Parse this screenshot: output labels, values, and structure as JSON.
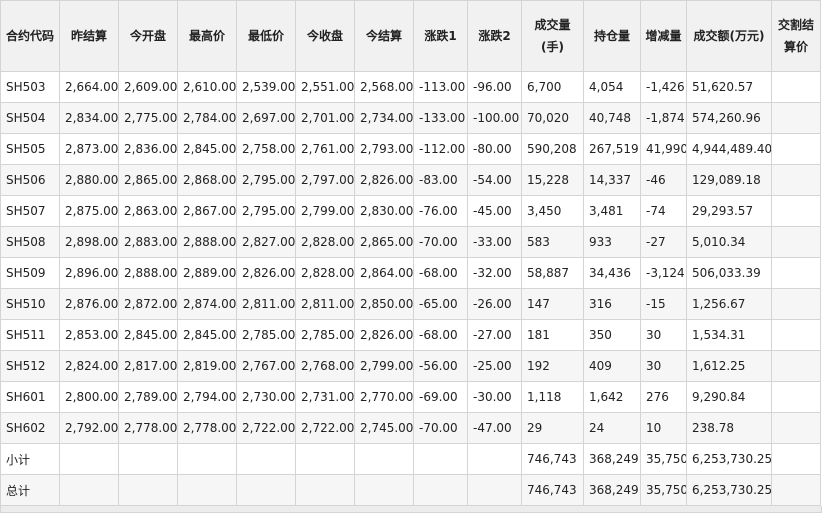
{
  "columns": [
    "合约代码",
    "昨结算",
    "今开盘",
    "最高价",
    "最低价",
    "今收盘",
    "今结算",
    "涨跌1",
    "涨跌2",
    "成交量(手)",
    "持仓量",
    "增减量",
    "成交额(万元)",
    "交割结算价"
  ],
  "rows": [
    [
      "SH503",
      "2,664.00",
      "2,609.00",
      "2,610.00",
      "2,539.00",
      "2,551.00",
      "2,568.00",
      "-113.00",
      "-96.00",
      "6,700",
      "4,054",
      "-1,426",
      "51,620.57",
      ""
    ],
    [
      "SH504",
      "2,834.00",
      "2,775.00",
      "2,784.00",
      "2,697.00",
      "2,701.00",
      "2,734.00",
      "-133.00",
      "-100.00",
      "70,020",
      "40,748",
      "-1,874",
      "574,260.96",
      ""
    ],
    [
      "SH505",
      "2,873.00",
      "2,836.00",
      "2,845.00",
      "2,758.00",
      "2,761.00",
      "2,793.00",
      "-112.00",
      "-80.00",
      "590,208",
      "267,519",
      "41,990",
      "4,944,489.40",
      ""
    ],
    [
      "SH506",
      "2,880.00",
      "2,865.00",
      "2,868.00",
      "2,795.00",
      "2,797.00",
      "2,826.00",
      "-83.00",
      "-54.00",
      "15,228",
      "14,337",
      "-46",
      "129,089.18",
      ""
    ],
    [
      "SH507",
      "2,875.00",
      "2,863.00",
      "2,867.00",
      "2,795.00",
      "2,799.00",
      "2,830.00",
      "-76.00",
      "-45.00",
      "3,450",
      "3,481",
      "-74",
      "29,293.57",
      ""
    ],
    [
      "SH508",
      "2,898.00",
      "2,883.00",
      "2,888.00",
      "2,827.00",
      "2,828.00",
      "2,865.00",
      "-70.00",
      "-33.00",
      "583",
      "933",
      "-27",
      "5,010.34",
      ""
    ],
    [
      "SH509",
      "2,896.00",
      "2,888.00",
      "2,889.00",
      "2,826.00",
      "2,828.00",
      "2,864.00",
      "-68.00",
      "-32.00",
      "58,887",
      "34,436",
      "-3,124",
      "506,033.39",
      ""
    ],
    [
      "SH510",
      "2,876.00",
      "2,872.00",
      "2,874.00",
      "2,811.00",
      "2,811.00",
      "2,850.00",
      "-65.00",
      "-26.00",
      "147",
      "316",
      "-15",
      "1,256.67",
      ""
    ],
    [
      "SH511",
      "2,853.00",
      "2,845.00",
      "2,845.00",
      "2,785.00",
      "2,785.00",
      "2,826.00",
      "-68.00",
      "-27.00",
      "181",
      "350",
      "30",
      "1,534.31",
      ""
    ],
    [
      "SH512",
      "2,824.00",
      "2,817.00",
      "2,819.00",
      "2,767.00",
      "2,768.00",
      "2,799.00",
      "-56.00",
      "-25.00",
      "192",
      "409",
      "30",
      "1,612.25",
      ""
    ],
    [
      "SH601",
      "2,800.00",
      "2,789.00",
      "2,794.00",
      "2,730.00",
      "2,731.00",
      "2,770.00",
      "-69.00",
      "-30.00",
      "1,118",
      "1,642",
      "276",
      "9,290.84",
      ""
    ],
    [
      "SH602",
      "2,792.00",
      "2,778.00",
      "2,778.00",
      "2,722.00",
      "2,722.00",
      "2,745.00",
      "-70.00",
      "-47.00",
      "29",
      "24",
      "10",
      "238.78",
      ""
    ],
    [
      "小计",
      "",
      "",
      "",
      "",
      "",
      "",
      "",
      "",
      "746,743",
      "368,249",
      "35,750",
      "6,253,730.25",
      ""
    ],
    [
      "总计",
      "",
      "",
      "",
      "",
      "",
      "",
      "",
      "",
      "746,743",
      "368,249",
      "35,750",
      "6,253,730.25",
      ""
    ]
  ]
}
